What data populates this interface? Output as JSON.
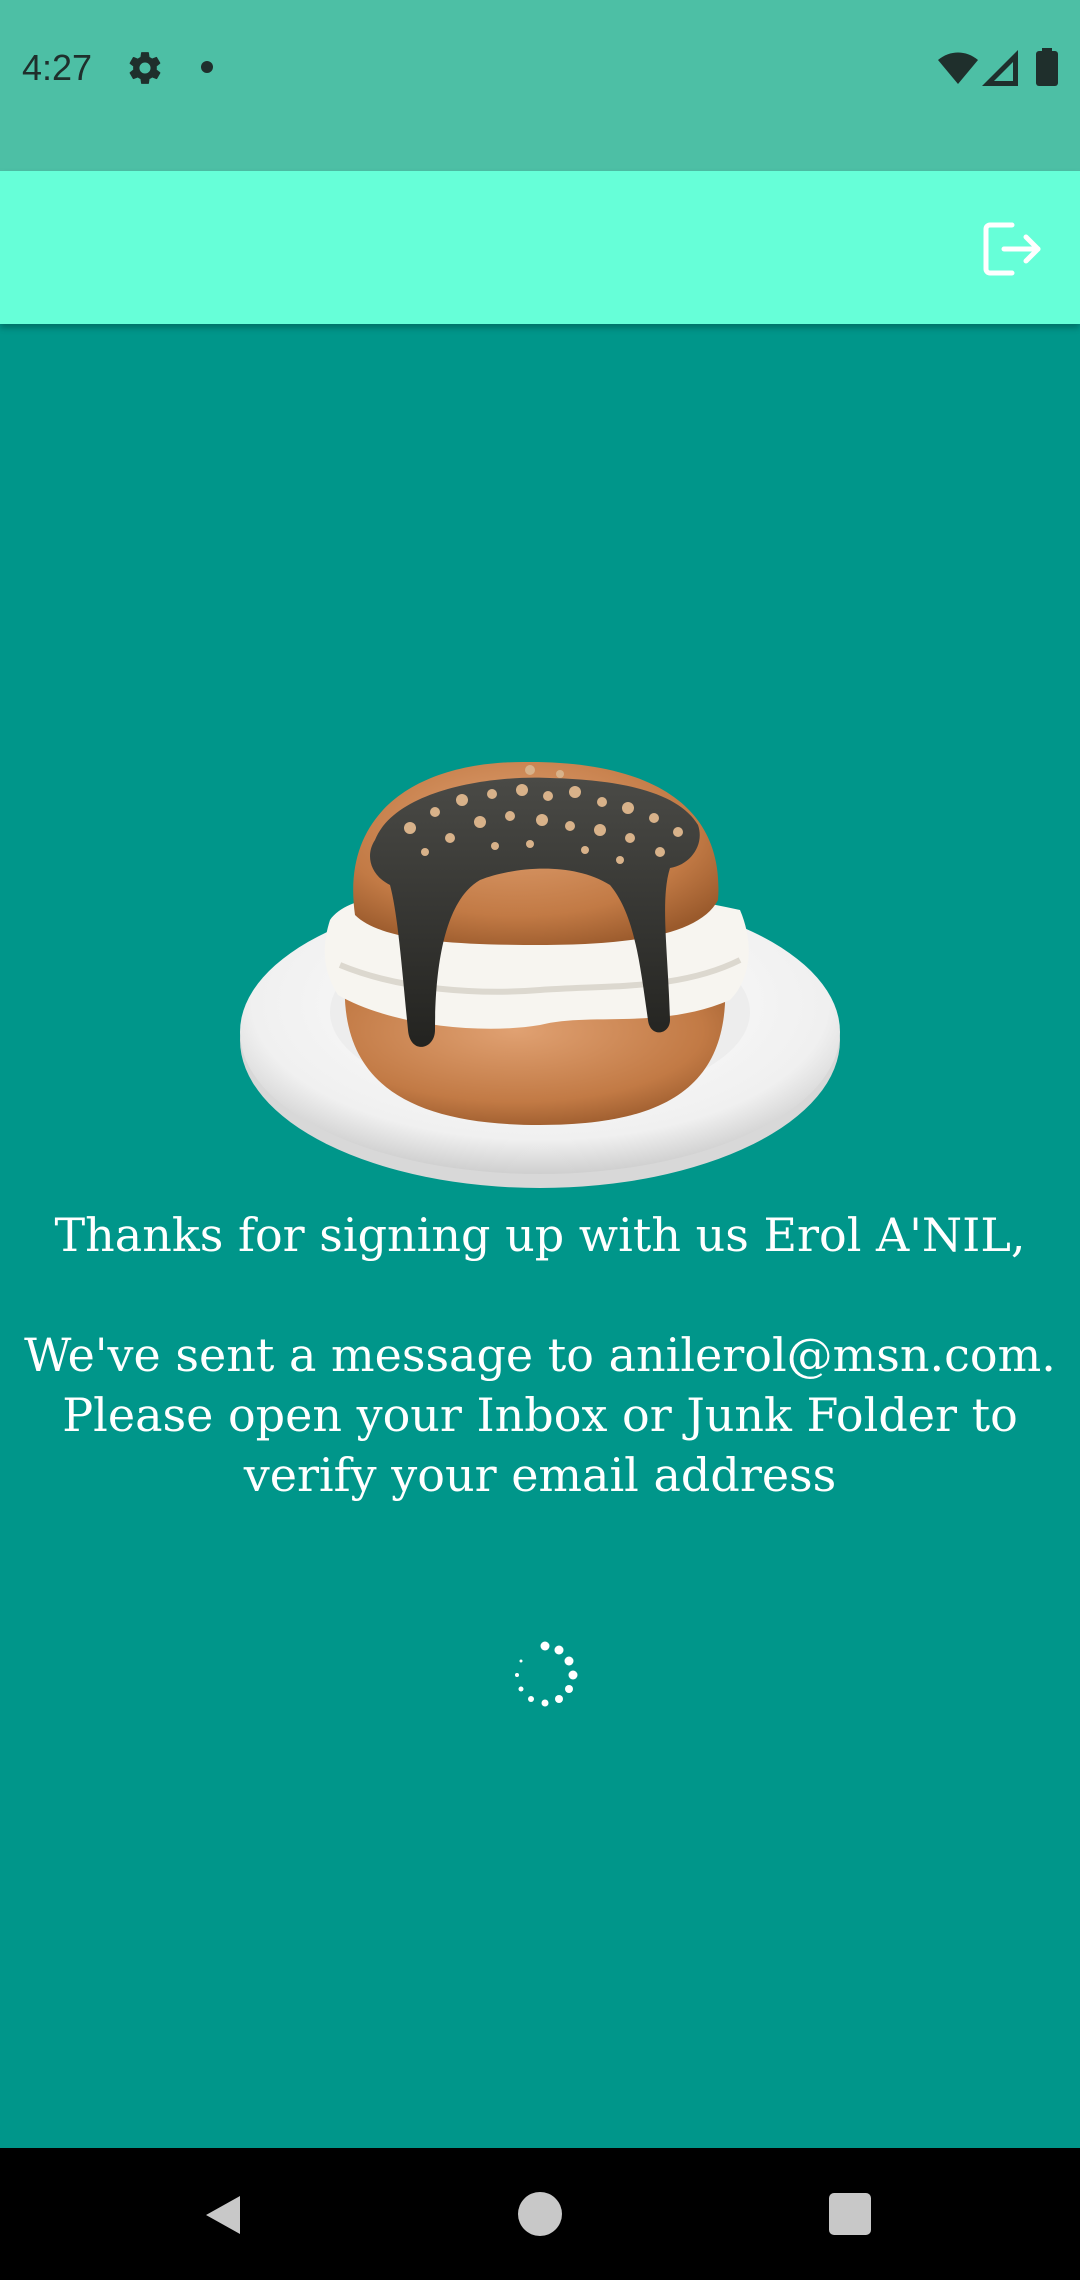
{
  "status_bar": {
    "time": "4:27",
    "icons": [
      "gear-icon",
      "notification-dot-icon",
      "wifi-icon",
      "signal-icon",
      "battery-icon"
    ]
  },
  "app_bar": {
    "logout_icon": "logout-icon",
    "background": "#66ffd8"
  },
  "main": {
    "background": "#00968a",
    "greeting": "Thanks for signing up with us Erol A'NIL,",
    "message_line1": "We've sent a message to anilerol@msn.com.",
    "message_line2": "Please open your Inbox or Junk Folder to",
    "message_line3": "verify your email address",
    "hero_image": "cream-bun-on-plate",
    "loading": "loading-spinner-icon"
  },
  "nav_bar": {
    "icons": [
      "back-icon",
      "home-icon",
      "recents-icon"
    ]
  }
}
